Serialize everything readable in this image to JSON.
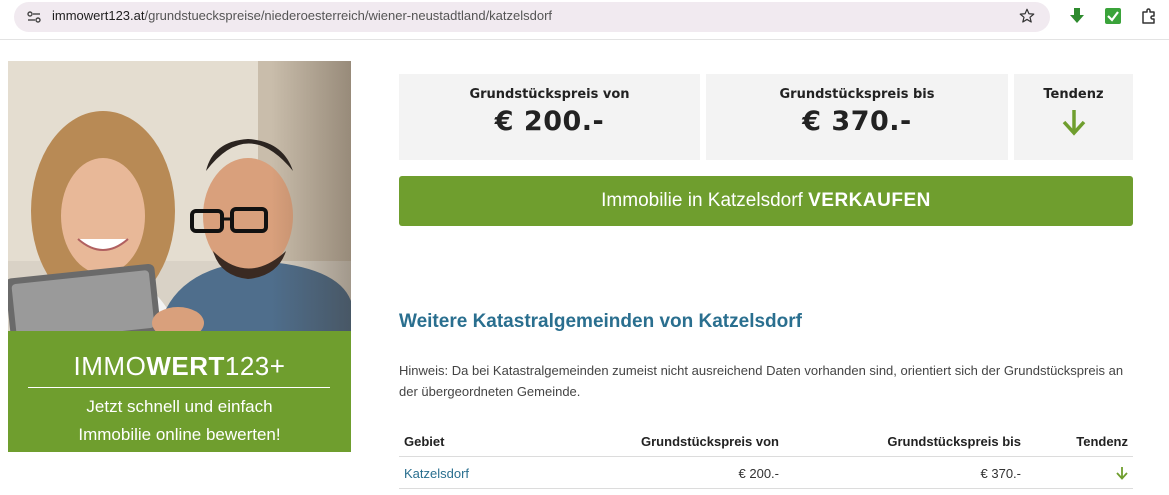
{
  "browser": {
    "url_host": "immowert123.at",
    "url_path": "/grundstueckspreise/niederoesterreich/wiener-neustadtland/katzelsdorf"
  },
  "promo": {
    "logo_light_1": "IMMO",
    "logo_bold": "WERT",
    "logo_light_2": "123+",
    "slogan_line1": "Jetzt schnell und einfach",
    "slogan_line2": "Immobilie online bewerten!",
    "banner_color": "#6f9e2e"
  },
  "prices": {
    "from_label": "Grundstückspreis von",
    "from_value": "€ 200.-",
    "to_label": "Grundstückspreis bis",
    "to_value": "€ 370.-",
    "trend_label": "Tendenz",
    "trend_icon": "arrow-down-icon"
  },
  "sell_button": {
    "prefix": "Immobilie in Katzelsdorf ",
    "bold": "VERKAUFEN"
  },
  "section": {
    "title": "Weitere Katastralgemeinden von Katzelsdorf",
    "hint": "Hinweis: Da bei Katastralgemeinden zumeist nicht ausreichend Daten vorhanden sind, orientiert sich der Grundstückspreis an der übergeordneten Gemeinde."
  },
  "table": {
    "headers": [
      "Gebiet",
      "Grundstückspreis von",
      "Grundstückspreis bis",
      "Tendenz"
    ],
    "rows": [
      {
        "area": "Katzelsdorf",
        "from": "€ 200.-",
        "to": "€ 370.-",
        "trend": "arrow-down-icon"
      }
    ]
  },
  "colors": {
    "accent_green": "#6f9e2e",
    "heading_blue": "#2a6f8f"
  }
}
